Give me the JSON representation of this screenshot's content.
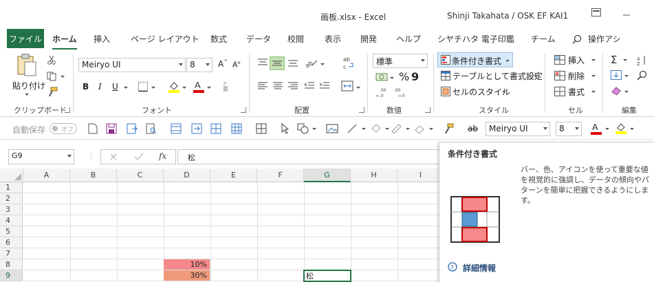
{
  "window": {
    "title": "画板.xlsx  -  Excel",
    "user": "Shinji Takahata / OSK EF KAI1"
  },
  "tabs": [
    "ファイル",
    "ホーム",
    "挿入",
    "ページ レイアウト",
    "数式",
    "データ",
    "校閲",
    "表示",
    "開発",
    "ヘルプ",
    "シヤチハタ 電子印鑑",
    "チーム",
    "操作アシ"
  ],
  "ribbon": {
    "clipboard": {
      "paste": "貼り付け",
      "label": "クリップボード"
    },
    "font": {
      "name": "Meiryo UI",
      "size": "8",
      "label": "フォント",
      "bold": "B",
      "italic": "I",
      "underline": "U"
    },
    "alignment": {
      "label": "配置"
    },
    "number": {
      "format": "標準",
      "label": "数値",
      "percent": "%"
    },
    "styles": {
      "conditional": "条件付き書式",
      "table": "テーブルとして書式設定",
      "cellstyle": "セルのスタイル",
      "label": "スタイル"
    },
    "cells": {
      "insert": "挿入",
      "delete": "削除",
      "format": "書式",
      "label": "セル"
    },
    "editing": {
      "label": "編集"
    }
  },
  "qat": {
    "autosave": "自動保存",
    "autosave_state": "オフ",
    "font": "Meiryo UI",
    "size": "8"
  },
  "formula": {
    "namebox": "G9",
    "fx": "fx",
    "content": "松"
  },
  "grid": {
    "columns": [
      "A",
      "B",
      "C",
      "D",
      "E",
      "F",
      "G",
      "H",
      "I"
    ],
    "rows": [
      "1",
      "2",
      "3",
      "4",
      "5",
      "6",
      "7",
      "8",
      "9"
    ],
    "cells": [
      {
        "ref": "D8",
        "value": "10%",
        "color": "#f4888a"
      },
      {
        "ref": "D9",
        "value": "30%",
        "color": "#ef9a7b"
      },
      {
        "ref": "G9",
        "value": "松",
        "color": "#ffffff"
      }
    ]
  },
  "tooltip": {
    "title": "条件付き書式",
    "description": "バー、色、アイコンを使って重要な値を視覚的に強調し、データの傾向やパターンを簡単に把握できるようにします。",
    "more": "詳細情報"
  },
  "colors": {
    "accent": "#217346",
    "highlight_red": "#f4888a",
    "highlight_blue": "#5b9bd5"
  }
}
